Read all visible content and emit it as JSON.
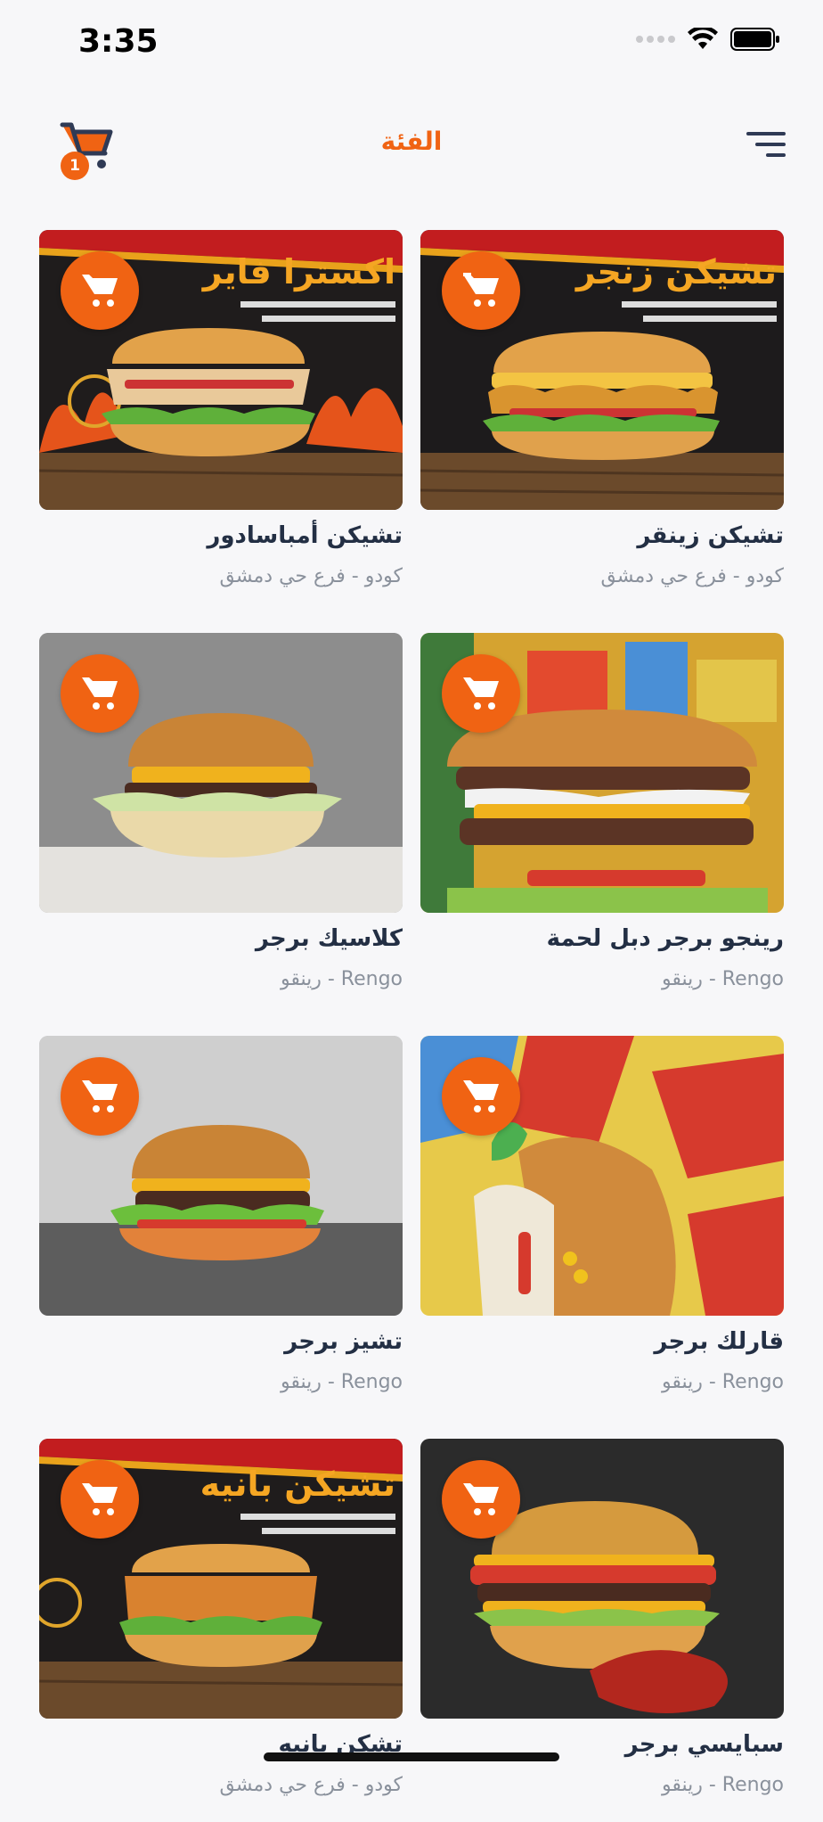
{
  "status_bar": {
    "time": "3:35"
  },
  "header": {
    "title": "الفئة",
    "cart_count": "1"
  },
  "colors": {
    "accent": "#f06313",
    "title_text": "#232f44",
    "subtitle_text": "#8a919c"
  },
  "products": [
    {
      "name": "تشيكن زينقر",
      "store": "كودو - فرع حي دمشق",
      "banner_text": "تشيكن زنجر"
    },
    {
      "name": "تشيكن أمباسادور",
      "store": "كودو - فرع حي دمشق",
      "banner_text": "اكسترا فاير"
    },
    {
      "name": "رينجو برجر دبل لحمة",
      "store": "Rengo - رينقو"
    },
    {
      "name": "كلاسيك برجر",
      "store": "Rengo - رينقو"
    },
    {
      "name": "قارلك برجر",
      "store": "Rengo - رينقو"
    },
    {
      "name": "تشيز برجر",
      "store": "Rengo - رينقو"
    },
    {
      "name": "سبايسي برجر",
      "store": "Rengo - رينقو"
    },
    {
      "name": "تشكن بانيه",
      "store": "كودو - فرع حي دمشق",
      "banner_text": "تشيكن بانيه"
    }
  ]
}
